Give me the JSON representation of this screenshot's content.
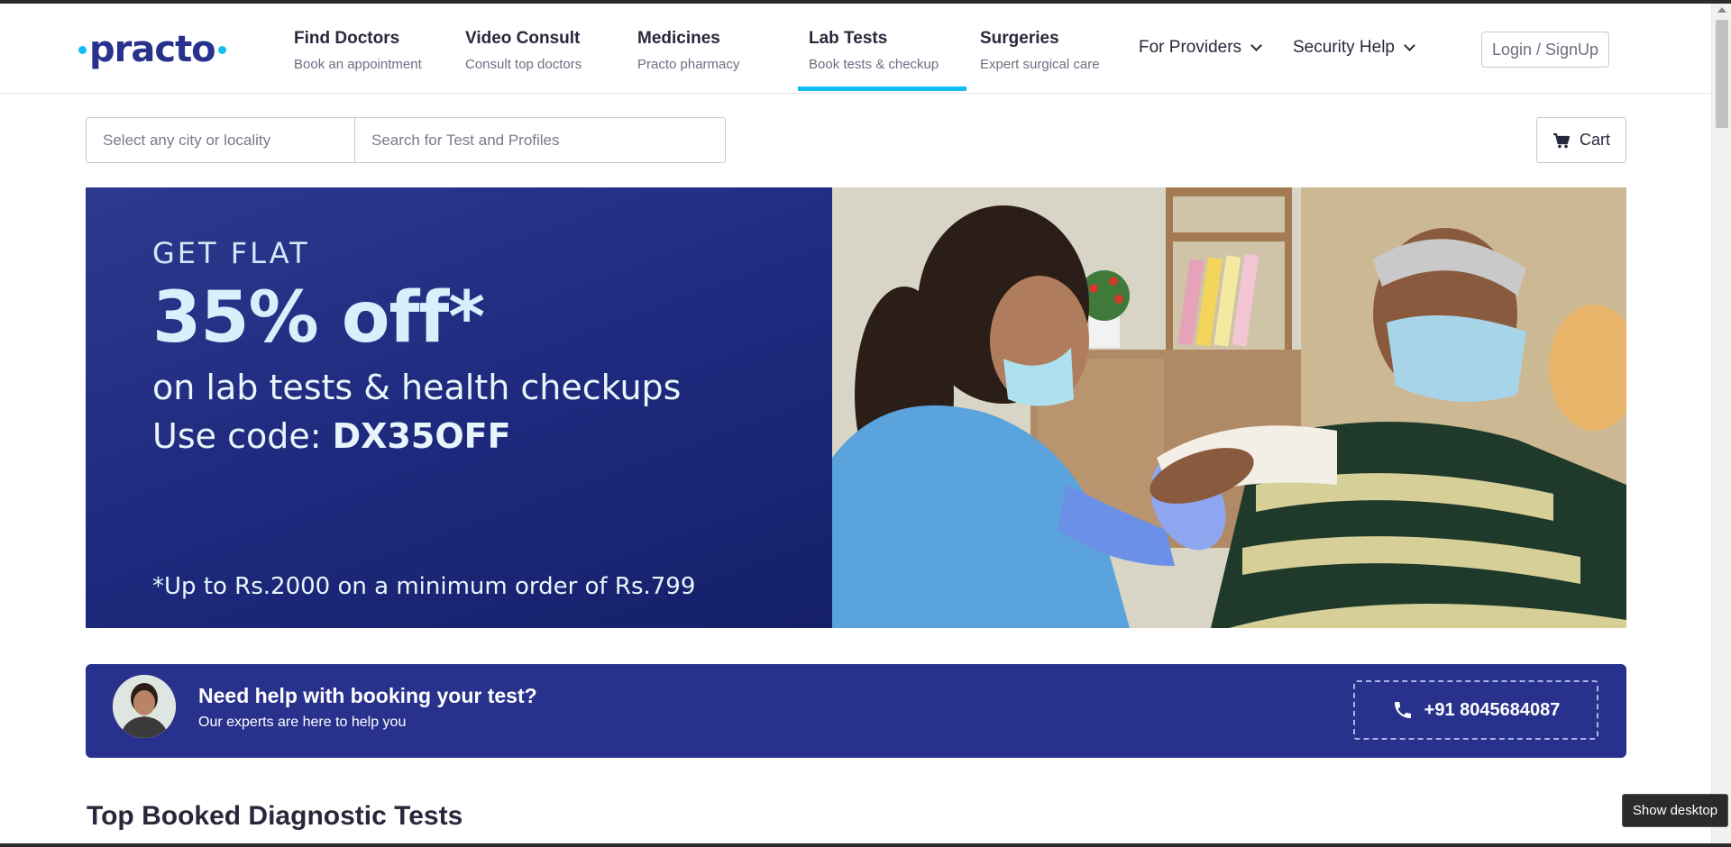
{
  "header": {
    "logo_text": "practo",
    "nav": [
      {
        "title": "Find Doctors",
        "sub": "Book an appointment"
      },
      {
        "title": "Video Consult",
        "sub": "Consult top doctors"
      },
      {
        "title": "Medicines",
        "sub": "Practo pharmacy"
      },
      {
        "title": "Lab Tests",
        "sub": "Book tests & checkup"
      },
      {
        "title": "Surgeries",
        "sub": "Expert surgical care"
      }
    ],
    "active_nav": "Lab Tests",
    "for_providers": "For Providers",
    "security_help": "Security Help",
    "login": "Login / SignUp"
  },
  "search": {
    "city_placeholder": "Select any city or locality",
    "test_placeholder": "Search for Test and Profiles",
    "cart_label": "Cart"
  },
  "banner": {
    "line1": "GET FLAT",
    "line2": "35% off*",
    "line3": "on lab tests & health checkups",
    "line4_prefix": "Use code: ",
    "line4_code": "DX35OFF",
    "footnote": "*Up to Rs.2000 on a minimum order of Rs.799"
  },
  "help": {
    "title": "Need help with booking your test?",
    "subtitle": "Our experts are here to help you",
    "phone": "+91 8045684087"
  },
  "section_title": "Top Booked Diagnostic Tests",
  "taskbar": {
    "show_desktop": "Show desktop"
  },
  "colors": {
    "brand_blue": "#14bef0",
    "brand_navy": "#28328c",
    "text_dark": "#28283c"
  }
}
